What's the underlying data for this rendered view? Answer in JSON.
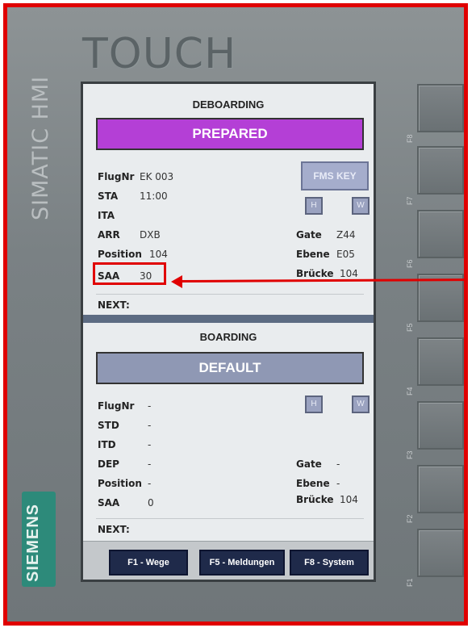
{
  "device": {
    "logo_text": "TOUCH",
    "model_text": "SIMATIC HMI",
    "brand_text": "SIEMENS",
    "function_keys": [
      "F8",
      "F7",
      "F6",
      "F5",
      "F4",
      "F3",
      "F2",
      "F1"
    ]
  },
  "deboarding": {
    "title": "DEBOARDING",
    "status": "PREPARED",
    "status_color": "#b43fd6",
    "fms_key": "FMS KEY",
    "h_label": "H",
    "w_label": "W",
    "fields": [
      {
        "label": "FlugNr",
        "value": "EK 003"
      },
      {
        "label": "STA",
        "value": "11:00"
      },
      {
        "label": "ITA",
        "value": ""
      },
      {
        "label": "ARR",
        "value": "DXB"
      },
      {
        "label": "Position",
        "value": "104"
      },
      {
        "label": "SAA",
        "value": "30"
      }
    ],
    "right_fields": [
      {
        "label": "Gate",
        "value": "Z44"
      },
      {
        "label": "Ebene",
        "value": "E05"
      },
      {
        "label": "Brücke",
        "value": "104"
      }
    ],
    "next_label": "NEXT:"
  },
  "boarding": {
    "title": "BOARDING",
    "status": "DEFAULT",
    "status_color": "#8f98b4",
    "h_label": "H",
    "w_label": "W",
    "fields": [
      {
        "label": "FlugNr",
        "value": "-"
      },
      {
        "label": "STD",
        "value": "-"
      },
      {
        "label": "ITD",
        "value": "-"
      },
      {
        "label": "DEP",
        "value": "-"
      },
      {
        "label": "Position",
        "value": "-"
      },
      {
        "label": "SAA",
        "value": "0"
      }
    ],
    "right_fields": [
      {
        "label": "Gate",
        "value": "-"
      },
      {
        "label": "Ebene",
        "value": "-"
      },
      {
        "label": "Brücke",
        "value": "104"
      }
    ],
    "next_label": "NEXT:"
  },
  "nav": {
    "wege": "F1 - Wege",
    "meldungen": "F5 - Meldungen",
    "system": "F8 - System"
  },
  "colors": {
    "annotation": "#e00000",
    "nav_button": "#1f2a4a"
  }
}
